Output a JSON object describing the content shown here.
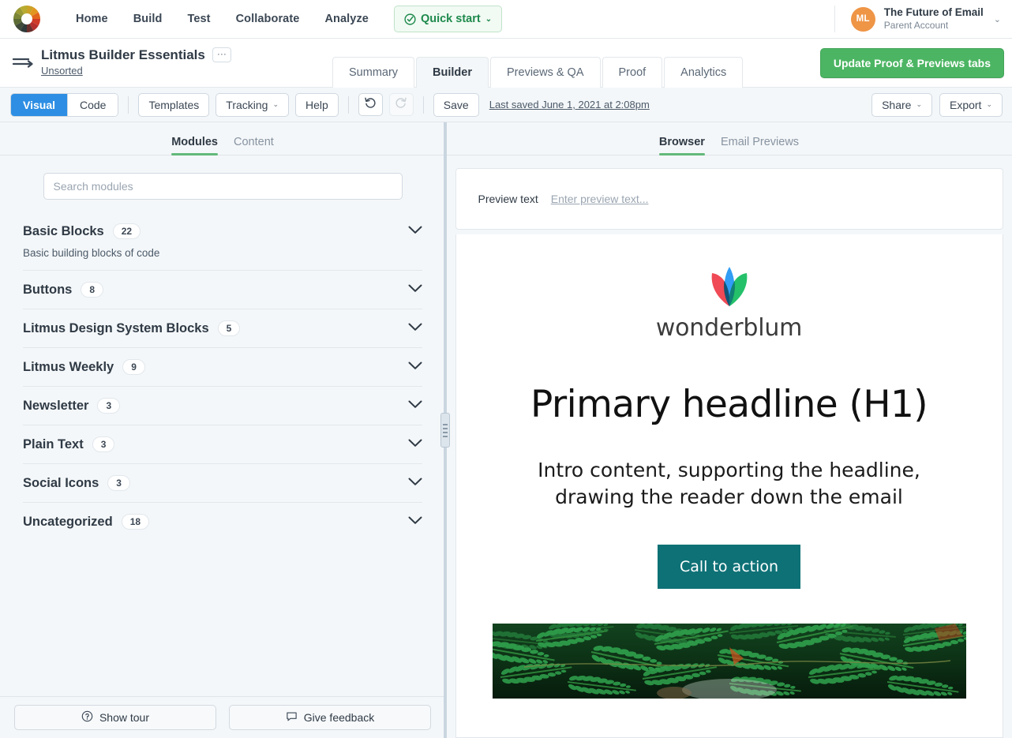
{
  "topnav": {
    "logo_icon": "litmus-color-wheel-logo",
    "links": [
      {
        "label": "Home"
      },
      {
        "label": "Build"
      },
      {
        "label": "Test"
      },
      {
        "label": "Collaborate"
      },
      {
        "label": "Analyze"
      }
    ],
    "quick_start": {
      "label": "Quick start",
      "icon": "check-circle-icon",
      "chevron": "⌄"
    },
    "account": {
      "initials": "ML",
      "name": "The Future of Email",
      "subtitle": "Parent Account",
      "chevron": "⌄"
    }
  },
  "subheader": {
    "back_icon": "back-arrow-icon",
    "title": "Litmus Builder Essentials",
    "kebab_label": "···",
    "folder": "Unsorted",
    "tabs": [
      {
        "label": "Summary",
        "active": false
      },
      {
        "label": "Builder",
        "active": true
      },
      {
        "label": "Previews & QA",
        "active": false
      },
      {
        "label": "Proof",
        "active": false
      },
      {
        "label": "Analytics",
        "active": false
      }
    ],
    "update_button": "Update Proof & Previews tabs"
  },
  "toolbar": {
    "mode": [
      {
        "label": "Visual",
        "active": true
      },
      {
        "label": "Code",
        "active": false
      }
    ],
    "templates_label": "Templates",
    "tracking_label": "Tracking",
    "help_label": "Help",
    "undo_icon": "undo-icon",
    "redo_icon": "redo-icon",
    "save_label": "Save",
    "last_saved": "Last saved June 1, 2021 at 2:08pm",
    "share_label": "Share",
    "export_label": "Export",
    "chevron": "⌄"
  },
  "left_panel": {
    "tabs": [
      {
        "label": "Modules",
        "active": true
      },
      {
        "label": "Content",
        "active": false
      }
    ],
    "search": {
      "placeholder": "Search modules",
      "value": ""
    },
    "groups": [
      {
        "title": "Basic Blocks",
        "count": "22",
        "description": "Basic building blocks of code"
      },
      {
        "title": "Buttons",
        "count": "8",
        "description": ""
      },
      {
        "title": "Litmus Design System Blocks",
        "count": "5",
        "description": ""
      },
      {
        "title": "Litmus Weekly",
        "count": "9",
        "description": ""
      },
      {
        "title": "Newsletter",
        "count": "3",
        "description": ""
      },
      {
        "title": "Plain Text",
        "count": "3",
        "description": ""
      },
      {
        "title": "Social Icons",
        "count": "3",
        "description": ""
      },
      {
        "title": "Uncategorized",
        "count": "18",
        "description": ""
      }
    ],
    "footer": {
      "show_tour": "Show tour",
      "show_tour_icon": "question-circle-icon",
      "give_feedback": "Give feedback",
      "give_feedback_icon": "speech-bubble-icon"
    },
    "splitter_icon": "vertical-resize-handle"
  },
  "right_panel": {
    "tabs": [
      {
        "label": "Browser",
        "active": true
      },
      {
        "label": "Email Previews",
        "active": false
      }
    ],
    "preview_text_label": "Preview text",
    "preview_text_value": "Enter preview text...",
    "email": {
      "logo_icon": "wonderblum-tulip-logo",
      "logo_word": "wonderblum",
      "headline": "Primary headline (H1)",
      "intro": "Intro content, supporting the headline, drawing the reader down the email",
      "cta_label": "Call to action",
      "hero_image_alt": "green-fern-leaves-photo"
    }
  },
  "colors": {
    "brand_green": "#4cb563",
    "tab_accent": "#63b97a",
    "visual_active": "#2d8ee3",
    "avatar": "#ef9546",
    "cta_teal": "#0e7176",
    "quick_start_green": "#1e8a4c",
    "page_bg": "#f4f7f9"
  }
}
